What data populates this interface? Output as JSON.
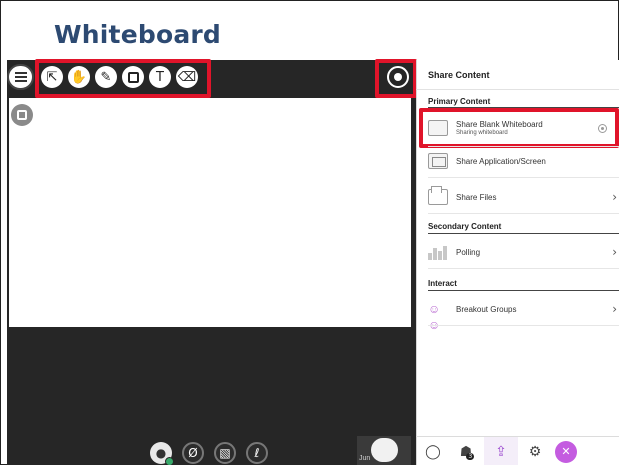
{
  "heading": "Whiteboard",
  "whiteboard": {
    "tools": [
      {
        "name": "select-tool",
        "icon": "arrow-pointer-icon",
        "glyph": "⇱"
      },
      {
        "name": "pan-tool",
        "icon": "hand-icon",
        "glyph": "✋"
      },
      {
        "name": "draw-tool",
        "icon": "pencil-icon",
        "glyph": "✎"
      },
      {
        "name": "shape-tool",
        "icon": "square-icon",
        "glyph": ""
      },
      {
        "name": "text-tool",
        "icon": "text-icon",
        "glyph": "T"
      },
      {
        "name": "eraser-tool",
        "icon": "eraser-icon",
        "glyph": "⌫"
      }
    ]
  },
  "session_controls": [
    {
      "name": "mic-toggle",
      "icon": "mic-off-icon",
      "glyph": "Ø"
    },
    {
      "name": "camera-toggle",
      "icon": "camera-off-icon",
      "glyph": "▧"
    },
    {
      "name": "hand-raise",
      "icon": "raise-hand-icon",
      "glyph": "ℓ"
    }
  ],
  "participant": {
    "name": "Jun"
  },
  "panel": {
    "title": "Share Content",
    "primary_heading": "Primary Content",
    "share_whiteboard": {
      "label": "Share Blank Whiteboard",
      "status": "Sharing whiteboard"
    },
    "share_app": {
      "label": "Share Application/Screen"
    },
    "share_files": {
      "label": "Share Files"
    },
    "secondary_heading": "Secondary Content",
    "polling": {
      "label": "Polling"
    },
    "interact_heading": "Interact",
    "breakout": {
      "label": "Breakout Groups"
    },
    "chevron": "›"
  },
  "footer": {
    "chat_glyph": "◯",
    "attendees_glyph": "☗",
    "attendees_count": "3",
    "share_glyph": "⇪",
    "settings_glyph": "⚙",
    "close_glyph": "✕"
  },
  "colors": {
    "heading": "#2d4a72",
    "highlight": "#e0142a",
    "accent": "#9e4fd1",
    "board_background": "#262626"
  }
}
